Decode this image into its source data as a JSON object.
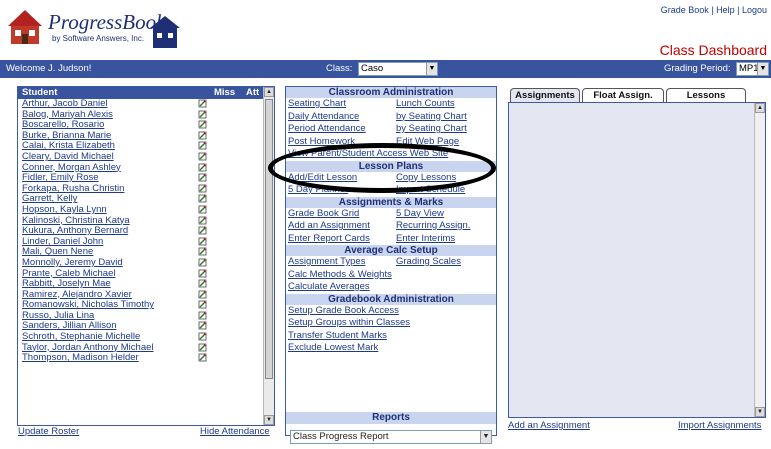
{
  "logo": {
    "text": "ProgressBook",
    "subtitle": "by Software Answers, Inc."
  },
  "top_links": [
    "Grade Book",
    "Help",
    "Logou"
  ],
  "dashboard_title": "Class Dashboard",
  "topbar": {
    "welcome": "Welcome J. Judson!",
    "class_label": "Class:",
    "class_value": "Caso",
    "period_label": "Grading Period:",
    "period_value": "MP1"
  },
  "roster": {
    "headers": {
      "student": "Student",
      "miss": "Miss",
      "att": "Att"
    },
    "students": [
      "Arthur, Jacob Daniel",
      "Balog, Mariyah Alexis",
      "Boscarello, Rosario",
      "Burke, Brianna Marie",
      "Calai, Krista Elizabeth",
      "Cleary, David Michael",
      "Conner, Morgan Ashley",
      "Fidler, Emily Rose",
      "Forkapa, Rusha Christin",
      "Garrett, Kelly",
      "Hopson, Kayla Lynn",
      "Kalinoski, Christina Katya",
      "Kukura, Anthony Bernard",
      "Linder, Daniel John",
      "Mali, Quen Nene",
      "Monnolly, Jeremy David",
      "Prante, Caleb Michael",
      "Rabbitt, Joselyn Mae",
      "Ramirez, Alejandro Xavier",
      "Romanowski, Nicholas Timothy",
      "Russo, Julia Lina",
      "Sanders, Jillian Allison",
      "Schroth, Stephanie Michelle",
      "Taylor, Jordan Anthony Michael",
      "Thompson, Madison Helder"
    ],
    "update_roster": "Update Roster",
    "hide_attendance": "Hide Attendance"
  },
  "admin": {
    "classroom_head": "Classroom Administration",
    "classroom_links": [
      [
        "Seating Chart",
        "Lunch Counts"
      ],
      [
        "Daily Attendance",
        "by Seating Chart"
      ],
      [
        "Period Attendance",
        "by Seating Chart"
      ],
      [
        "Post Homework",
        "Edit Web Page"
      ],
      [
        "View Parent/Student Access Web Site",
        ""
      ]
    ],
    "lesson_head": "Lesson Plans",
    "lesson_links": [
      [
        "Add/Edit Lesson",
        "Copy Lessons"
      ],
      [
        "5 Day Planner",
        "Import Schedule"
      ]
    ],
    "assign_head": "Assignments & Marks",
    "assign_links": [
      [
        "Grade Book Grid",
        "5 Day View"
      ],
      [
        "Add an Assignment",
        "Recurring Assign."
      ],
      [
        "Enter Report Cards",
        "Enter Interims"
      ]
    ],
    "calc_head": "Average Calc Setup",
    "calc_links": [
      [
        "Assignment Types",
        "Grading Scales"
      ],
      [
        "Calc Methods & Weights",
        ""
      ],
      [
        "Calculate Averages",
        ""
      ]
    ],
    "gb_head": "Gradebook Administration",
    "gb_links": [
      [
        "Setup Grade Book Access",
        ""
      ],
      [
        "Setup Groups within Classes",
        ""
      ],
      [
        "Transfer Student Marks",
        ""
      ],
      [
        "Exclude Lowest Mark",
        ""
      ]
    ],
    "reports_head": "Reports",
    "report_value": "Class Progress Report"
  },
  "tabs": [
    "Assignments",
    "Float Assign.",
    "Lessons"
  ],
  "right_links": {
    "add": "Add an Assignment",
    "import": "Import Assignments"
  },
  "colors": {
    "bar": "#38549f",
    "section": "#c9d5ef",
    "link": "#1e3a8a",
    "title": "#c00000"
  }
}
